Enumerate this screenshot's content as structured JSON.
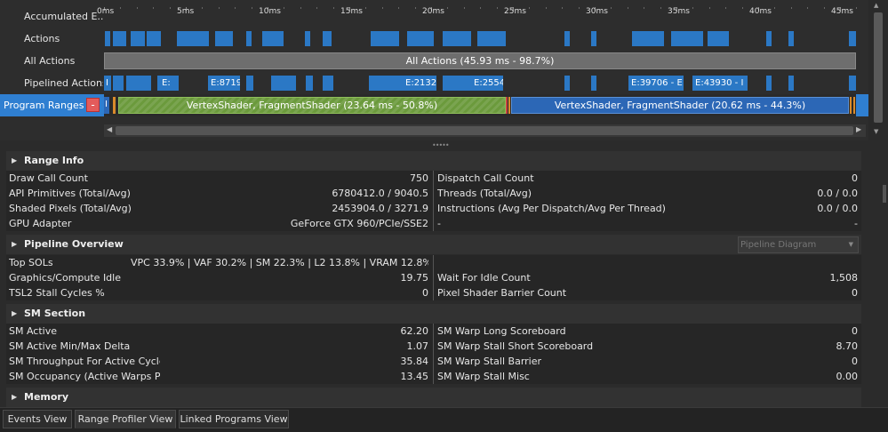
{
  "timeline": {
    "rows": [
      {
        "label": "Accumulated E..."
      },
      {
        "label": "Actions"
      },
      {
        "label": "All Actions"
      },
      {
        "label": "Pipelined Actions"
      },
      {
        "label": "Program Ranges"
      }
    ],
    "ruler": [
      "0ms",
      "5ms",
      "10ms",
      "15ms",
      "20ms",
      "25ms",
      "30ms",
      "35ms",
      "40ms",
      "45ms"
    ],
    "all_actions_bar": "All Actions (45.93 ms - 98.7%)",
    "pipelined_labels": [
      "I",
      "E:",
      "E:8719",
      "E:2132",
      "E:2554",
      "E:39706 - E",
      "E:43930 - I"
    ],
    "program_first_label": "I",
    "collapse_symbol": "-",
    "range_green": "VertexShader, FragmentShader (23.64 ms - 50.8%)",
    "range_blue": "VertexShader, FragmentShader (20.62 ms - 44.3%)",
    "colors": {
      "action_blue": "#2b78c5",
      "program_row": "#2f7fd1",
      "green_range": "#6b9a3c",
      "blue_range": "#2c67b6"
    }
  },
  "sections": {
    "range_info": {
      "title": "Range Info",
      "rows": [
        {
          "lname": "Draw Call Count",
          "lval": "750",
          "rname": "Dispatch Call Count",
          "rval": "0"
        },
        {
          "lname": "API Primitives (Total/Avg)",
          "lval": "6780412.0 / 9040.5",
          "rname": "Threads (Total/Avg)",
          "rval": "0.0 / 0.0"
        },
        {
          "lname": "Shaded Pixels (Total/Avg)",
          "lval": "2453904.0 / 3271.9",
          "rname": "Instructions (Avg Per Dispatch/Avg Per Thread)",
          "rval": "0.0 / 0.0"
        },
        {
          "lname": "GPU Adapter",
          "lval": "GeForce GTX 960/PCIe/SSE2",
          "rname": "-",
          "rval": "-"
        }
      ]
    },
    "pipeline_overview": {
      "title": "Pipeline Overview",
      "dropdown": "Pipeline Diagram",
      "rows": [
        {
          "lname": "Top SOLs",
          "lval": "VPC 33.9% | VAF 30.2% | SM 22.3% | L2 13.8% | VRAM 12.8%",
          "rname": "",
          "rval": ""
        },
        {
          "lname": "Graphics/Compute Idle",
          "lval": "19.75",
          "rname": "Wait For Idle Count",
          "rval": "1,508"
        },
        {
          "lname": "TSL2 Stall Cycles %",
          "lval": "0",
          "rname": "Pixel Shader Barrier Count",
          "rval": "0"
        }
      ]
    },
    "sm_section": {
      "title": "SM Section",
      "rows": [
        {
          "lname": "SM Active",
          "lval": "62.20",
          "rname": "SM Warp Long Scoreboard",
          "rval": "0"
        },
        {
          "lname": "SM Active Min/Max Delta",
          "lval": "1.07",
          "rname": "SM Warp Stall Short Scoreboard",
          "rval": "8.70"
        },
        {
          "lname": "SM Throughput For Active Cycles",
          "lval": "35.84",
          "rname": "SM Warp Stall Barrier",
          "rval": "0"
        },
        {
          "lname": "SM Occupancy (Active Warps Per Active Cycle)",
          "lval": "13.45",
          "rname": "SM Warp Stall Misc",
          "rval": "0.00"
        }
      ]
    },
    "memory": {
      "title": "Memory"
    }
  },
  "tabs": [
    "Events View",
    "Range Profiler View",
    "Linked Programs View"
  ],
  "active_tab": "Range Profiler View"
}
